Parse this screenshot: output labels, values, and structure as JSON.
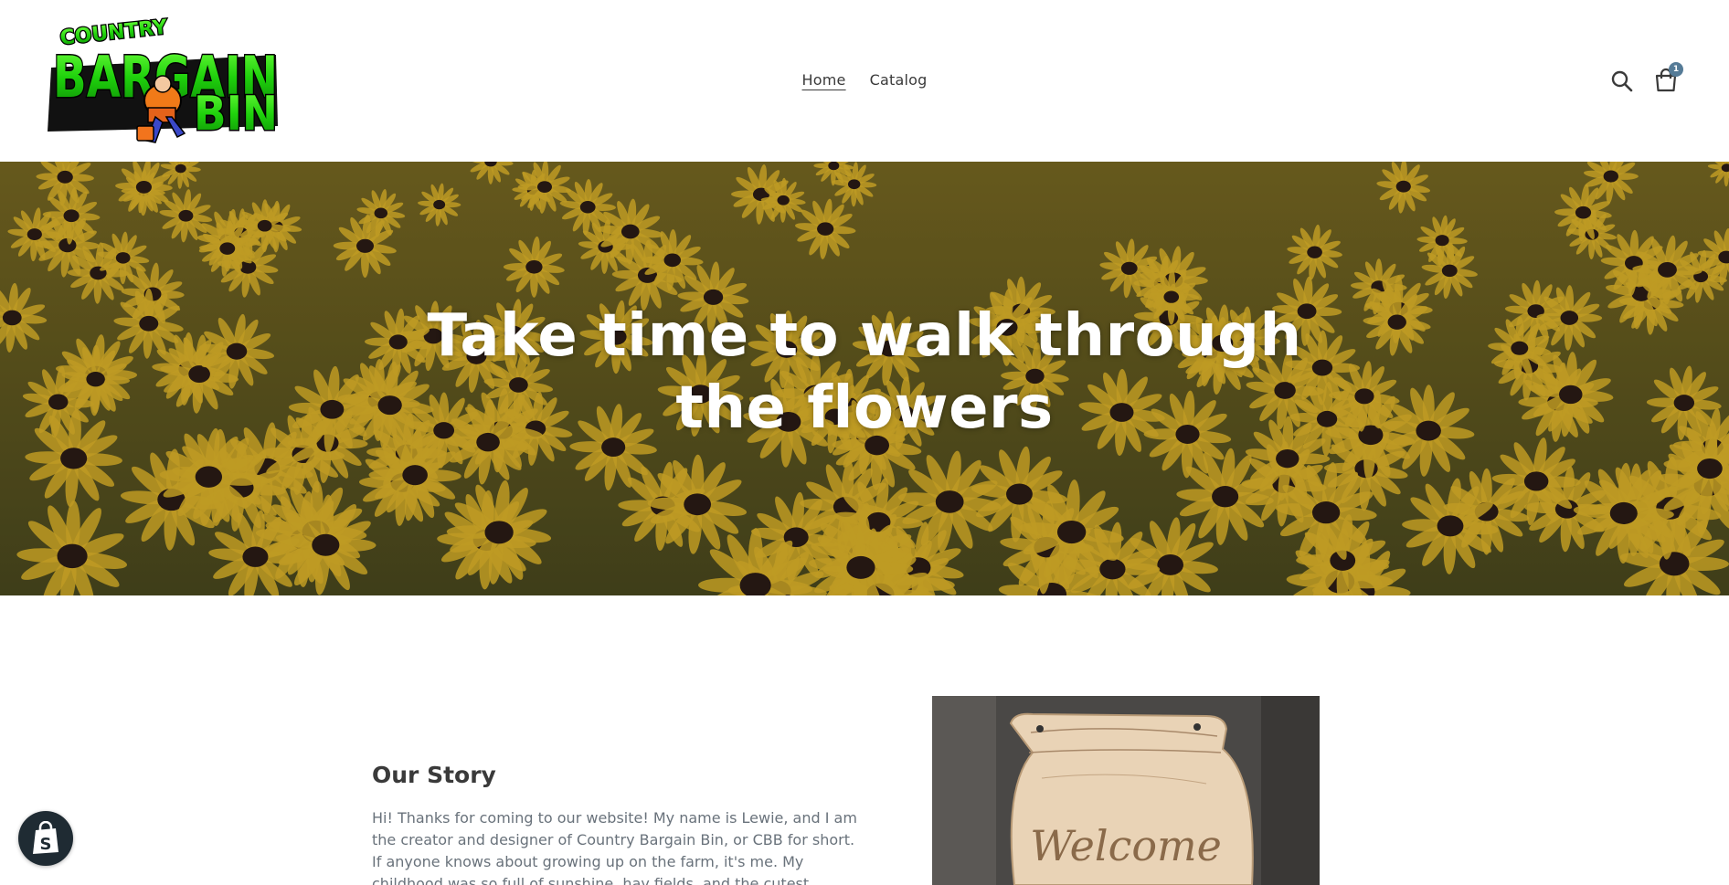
{
  "header": {
    "logo": {
      "top_text": "COUNTRY",
      "main_text_1": "BARGAIN",
      "main_text_2": "BIN"
    },
    "nav": {
      "items": [
        {
          "label": "Home",
          "active": true
        },
        {
          "label": "Catalog",
          "active": false
        }
      ]
    },
    "icons": {
      "search": "search-icon",
      "cart": "cart-icon"
    },
    "cart_count": "1"
  },
  "hero": {
    "title": "Take time to walk through the flowers"
  },
  "story": {
    "heading": "Our Story",
    "text": "Hi! Thanks for coming to our website! My name is Lewie, and I am the creator and designer of Country Bargain Bin, or CBB for short. If anyone knows about growing up on the farm, it's me. My childhood was so full of sunshine, hay fields, and the cutest",
    "image_text": "Welcome"
  },
  "badge": {
    "icon": "shopify-bag-icon"
  },
  "colors": {
    "accent": "#557b97",
    "flower_yellow": "#e3b92a",
    "flower_center": "#2b1c16",
    "logo_green": "#2fe01a"
  }
}
